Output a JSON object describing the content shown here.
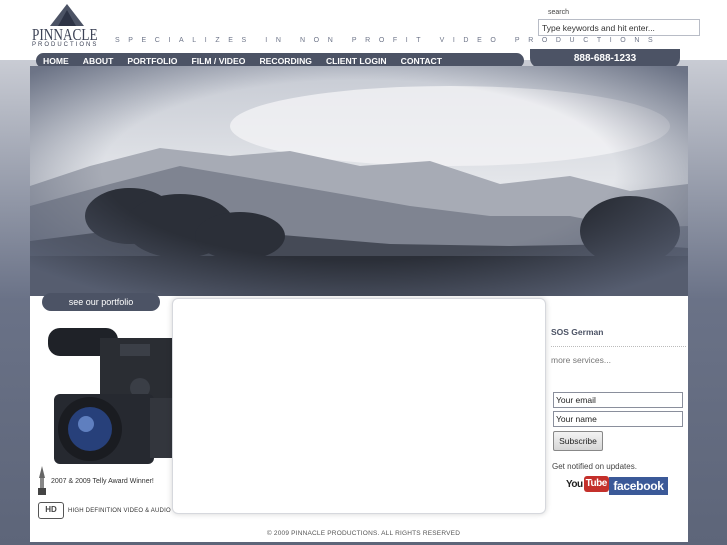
{
  "header": {
    "logo_text": "PINNACLE",
    "logo_sub": "PRODUCTIONS",
    "tagline": "SPECIALIZES IN NON PROFIT VIDEO PRODUCTIONS",
    "search_label": "search",
    "search_placeholder": "Type keywords and hit enter..."
  },
  "nav": {
    "items": [
      {
        "label": "HOME"
      },
      {
        "label": "ABOUT"
      },
      {
        "label": "PORTFOLIO"
      },
      {
        "label": "FILM / VIDEO"
      },
      {
        "label": "RECORDING"
      },
      {
        "label": "CLIENT LOGIN"
      },
      {
        "label": "CONTACT"
      }
    ],
    "phone": "888-688-1233"
  },
  "content": {
    "portfolio_button": "see our portfolio",
    "telly_text": "2007 & 2009 Telly Award Winner!",
    "hd_badge": "HD",
    "hd_text": "HIGH DEFINITION VIDEO & AUDIO"
  },
  "sidebar": {
    "title": "SOS German",
    "more_link": "more services...",
    "email_placeholder": "Your email",
    "name_placeholder": "Your name",
    "subscribe_label": "Subscribe",
    "notify_text": "Get notified on updates.",
    "youtube_you": "You",
    "youtube_tube": "Tube",
    "facebook_label": "facebook"
  },
  "footer": {
    "copyright": "© 2009 PINNACLE PRODUCTIONS. ALL RIGHTS RESERVED"
  },
  "colors": {
    "nav_bg": "#4c5365",
    "youtube_red": "#c4302b",
    "facebook_blue": "#3b5998"
  }
}
